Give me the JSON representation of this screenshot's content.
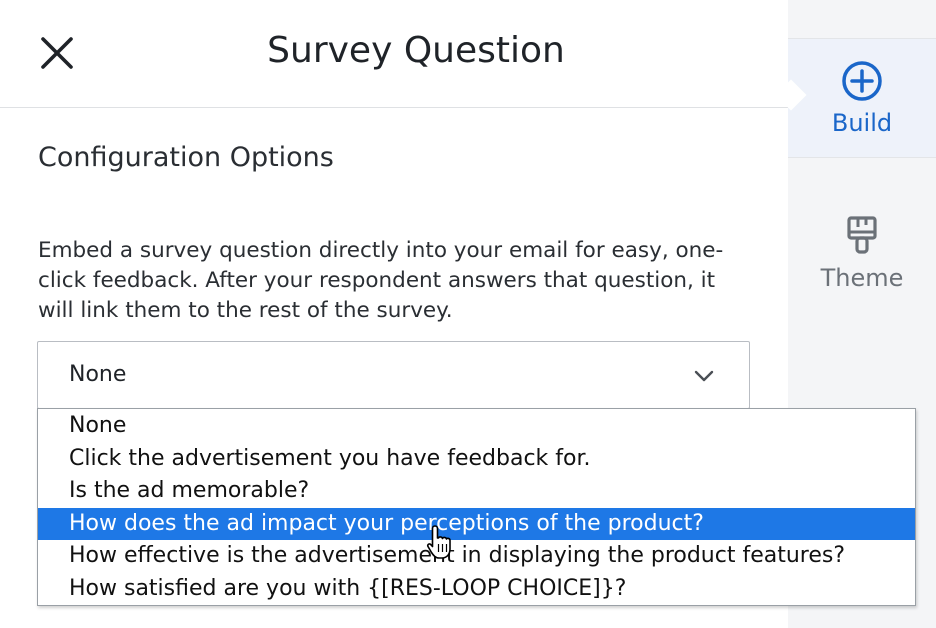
{
  "header": {
    "title": "Survey Question"
  },
  "config": {
    "section_title": "Configuration Options",
    "description": "Embed a survey question directly into your email for easy, one-click feedback. After your respondent answers that question, it will link them to the rest of the survey."
  },
  "select": {
    "selected": "None",
    "options": [
      "None",
      "Click the advertisement you have feedback for.",
      "Is the ad memorable?",
      "How does the ad impact your perceptions of the product?",
      "How effective is the advertisement in displaying the product features?",
      "How satisfied are you with {[RES-LOOP CHOICE]}?"
    ],
    "highlighted_index": 3
  },
  "rail": {
    "build_label": "Build",
    "theme_label": "Theme"
  },
  "colors": {
    "accent": "#1a66c9",
    "highlight": "#1e78e6"
  },
  "icons": {
    "close": "close-icon",
    "build": "plus-circle-icon",
    "theme": "paint-brush-icon",
    "chevron": "chevron-down-icon"
  }
}
